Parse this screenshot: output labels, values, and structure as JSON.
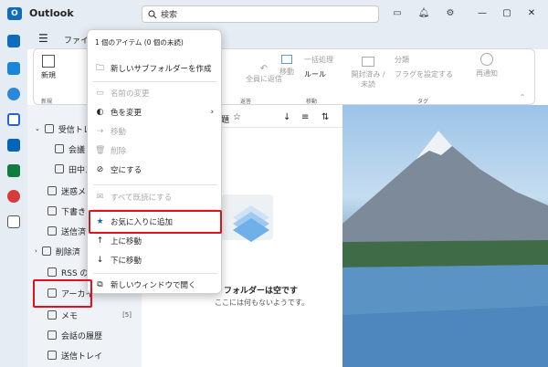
{
  "app": {
    "logo": "O",
    "title": "Outlook"
  },
  "search": {
    "placeholder": "検索"
  },
  "colors": {
    "highlight": "#e3101d",
    "accent": "#0f6cbd"
  },
  "ribbon": {
    "tab_partial": "ファイ",
    "new_label": "新規",
    "new_group": "新規",
    "reply_all": "全員に返信",
    "move": "移動",
    "batch": "一括処理",
    "rules": "ルール",
    "move_group": "移動",
    "respond_group": "返答",
    "read_unread": "開封済み / 未読",
    "categorize": "分類",
    "flag": "フラグを設定する",
    "tags_group": "タグ",
    "snooze": "再通知"
  },
  "folders": [
    {
      "label": "受信トレ",
      "icon": "inbox-icon"
    },
    {
      "label": "会議",
      "icon": "folder-icon"
    },
    {
      "label": "田中ス",
      "icon": "folder-icon"
    },
    {
      "label": "迷惑メ",
      "icon": "junk-icon"
    },
    {
      "label": "下書き",
      "icon": "draft-icon"
    },
    {
      "label": "送信済",
      "icon": "sent-icon"
    },
    {
      "label": "削除済",
      "icon": "trash-icon"
    },
    {
      "label": "RSS の",
      "icon": "rss-icon"
    },
    {
      "label": "アーカイ",
      "icon": "archive-icon"
    },
    {
      "label": "メモ",
      "icon": "note-icon",
      "count": "[5]"
    },
    {
      "label": "会話の履歴",
      "icon": "folder-icon"
    },
    {
      "label": "送信トレイ",
      "icon": "outbox-icon"
    }
  ],
  "list": {
    "header_partial": "題",
    "empty_title": "フォルダーは空です",
    "empty_sub": "ここには何もないようです。"
  },
  "menu": {
    "header": "1 個のアイテム (0 個の未読)",
    "items": [
      {
        "label": "新しいサブフォルダーを作成",
        "enabled": true
      },
      {
        "label": "名前の変更",
        "enabled": false
      },
      {
        "label": "色を変更",
        "enabled": true
      },
      {
        "label": "移動",
        "enabled": false
      },
      {
        "label": "削除",
        "enabled": false
      },
      {
        "label": "空にする",
        "enabled": true
      },
      {
        "label": "すべて既読にする",
        "enabled": false
      },
      {
        "label": "お気に入りに追加",
        "enabled": true
      },
      {
        "label": "上に移動",
        "enabled": true
      },
      {
        "label": "下に移動",
        "enabled": true
      },
      {
        "label": "新しいウィンドウで開く",
        "enabled": true
      }
    ]
  }
}
